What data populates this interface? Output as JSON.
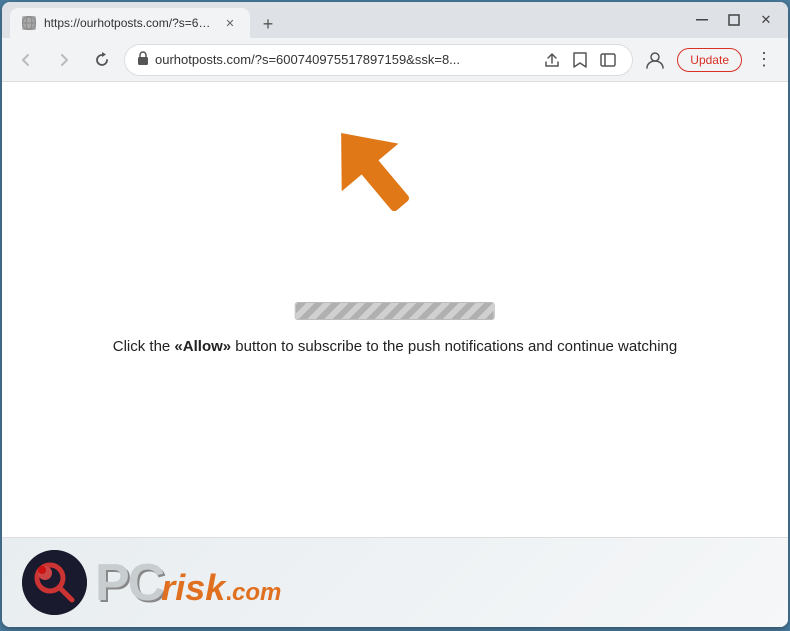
{
  "browser": {
    "title_bar": {
      "tab_title": "https://ourhotposts.com/?s=600...",
      "tab_favicon": "globe",
      "new_tab_label": "+",
      "window_controls": {
        "minimize": "−",
        "maximize": "□",
        "close": "×"
      }
    },
    "nav_bar": {
      "back_button": "←",
      "forward_button": "→",
      "reload_button": "✕",
      "url": "ourhotposts.com/?s=600740975517897159&ssk=8...",
      "lock_icon": "🔒",
      "share_icon": "⬆",
      "bookmark_icon": "☆",
      "sidebar_icon": "▣",
      "profile_icon": "👤",
      "update_button": "Update",
      "menu_button": "⋮"
    }
  },
  "page": {
    "progress_bar_width": "100%",
    "instruction_text": "Click the «Allow» button to subscribe to the push notifications and continue watching",
    "instruction_parts": {
      "prefix": "Click the ",
      "allow": "«Allow»",
      "suffix": " button to subscribe to the push notifications and continue watching"
    }
  },
  "logo": {
    "pc_text": "PC",
    "risk_text": "risk",
    "dot_text": ".",
    "com_text": "com"
  },
  "colors": {
    "orange_arrow": "#e07818",
    "update_button_border": "#d93025",
    "update_button_text": "#d93025",
    "logo_pc": "#c8cdd0",
    "logo_risk": "#e07020"
  }
}
